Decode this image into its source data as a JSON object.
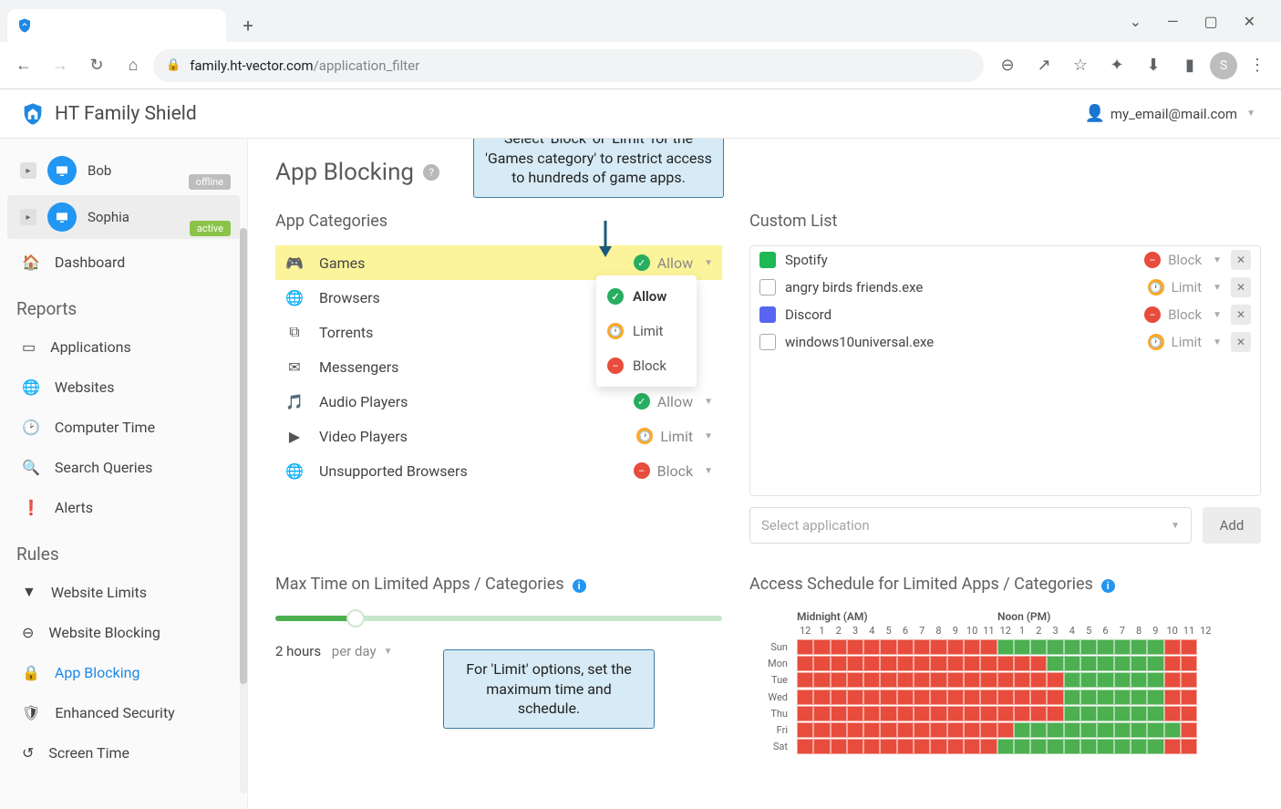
{
  "browser": {
    "url_host": "family.ht-vector.com",
    "url_path": "/application_filter",
    "avatar_letter": "S",
    "win": {
      "chev": "⌄",
      "min": "—",
      "max": "▢",
      "close": "✕"
    },
    "nav": {
      "back": "←",
      "forward": "→",
      "reload": "↻",
      "home": "⌂",
      "zoom": "⊖",
      "share": "↗",
      "star": "☆",
      "ext": "✦",
      "dl": "⬇",
      "panel": "▮",
      "menu": "⋮",
      "plus": "+",
      "lock": "🔒"
    }
  },
  "app": {
    "brand": "HT Family Shield",
    "user_email": "my_email@mail.com"
  },
  "sidebar": {
    "profiles": [
      {
        "name": "Bob",
        "status": "offline"
      },
      {
        "name": "Sophia",
        "status": "active"
      }
    ],
    "dashboard": "Dashboard",
    "sections": {
      "reports_title": "Reports",
      "reports": [
        "Applications",
        "Websites",
        "Computer Time",
        "Search Queries",
        "Alerts"
      ],
      "rules_title": "Rules",
      "rules": [
        "Website Limits",
        "Website Blocking",
        "App Blocking",
        "Enhanced Security",
        "Screen Time"
      ]
    }
  },
  "page": {
    "title": "App Blocking",
    "categories_title": "App Categories",
    "custom_title": "Custom List",
    "categories": [
      {
        "name": "Games",
        "status": "Allow",
        "status_kind": "allow",
        "highlight": true,
        "icon": "🎮"
      },
      {
        "name": "Browsers",
        "status": "",
        "status_kind": "",
        "icon": "🌐"
      },
      {
        "name": "Torrents",
        "status": "",
        "status_kind": "",
        "icon": "⧉"
      },
      {
        "name": "Messengers",
        "status": "",
        "status_kind": "",
        "icon": "✉"
      },
      {
        "name": "Audio Players",
        "status": "Allow",
        "status_kind": "allow",
        "icon": "🎵"
      },
      {
        "name": "Video Players",
        "status": "Limit",
        "status_kind": "limit",
        "icon": "▶"
      },
      {
        "name": "Unsupported Browsers",
        "status": "Block",
        "status_kind": "block",
        "icon": "🌐"
      }
    ],
    "dropdown": {
      "allow": "Allow",
      "limit": "Limit",
      "block": "Block"
    },
    "custom_list": [
      {
        "name": "Spotify",
        "status": "Block",
        "status_kind": "block",
        "color": "#1db954"
      },
      {
        "name": "angry birds friends.exe",
        "status": "Limit",
        "status_kind": "limit",
        "color": "#ffffff",
        "border": true
      },
      {
        "name": "Discord",
        "status": "Block",
        "status_kind": "block",
        "color": "#5865f2"
      },
      {
        "name": "windows10universal.exe",
        "status": "Limit",
        "status_kind": "limit",
        "color": "#ffffff",
        "border": true
      }
    ],
    "select_placeholder": "Select application",
    "add_btn": "Add",
    "maxtime": {
      "title": "Max Time on Limited Apps / Categories",
      "value_label": "2 hours",
      "unit_label": "per day"
    },
    "schedule": {
      "title": "Access Schedule for Limited Apps / Categories",
      "col_headers": [
        "Midnight (AM)",
        "Noon (PM)"
      ],
      "hours": [
        "12",
        "1",
        "2",
        "3",
        "4",
        "5",
        "6",
        "7",
        "8",
        "9",
        "10",
        "11",
        "12",
        "1",
        "2",
        "3",
        "4",
        "5",
        "6",
        "7",
        "8",
        "9",
        "10",
        "11",
        "12"
      ],
      "days": [
        "Sun",
        "Mon",
        "Tue",
        "Wed",
        "Thu",
        "Fri",
        "Sat"
      ]
    }
  },
  "callouts": {
    "top": "Select 'Block' or 'Limit' for the 'Games category' to restrict access to hundreds of game apps.",
    "bottom": "For 'Limit' options, set the maximum time and schedule."
  },
  "chart_data": {
    "type": "heatmap",
    "title": "Access Schedule for Limited Apps / Categories",
    "x_categories_hours_from_midnight": [
      0,
      1,
      2,
      3,
      4,
      5,
      6,
      7,
      8,
      9,
      10,
      11,
      12,
      13,
      14,
      15,
      16,
      17,
      18,
      19,
      20,
      21,
      22,
      23
    ],
    "y_categories_days": [
      "Sun",
      "Mon",
      "Tue",
      "Wed",
      "Thu",
      "Fri",
      "Sat"
    ],
    "legend": {
      "0": "blocked (red)",
      "1": "allowed (green)"
    },
    "values": [
      [
        0,
        0,
        0,
        0,
        0,
        0,
        0,
        0,
        0,
        0,
        0,
        0,
        1,
        1,
        1,
        1,
        1,
        1,
        1,
        1,
        1,
        1,
        0,
        0
      ],
      [
        0,
        0,
        0,
        0,
        0,
        0,
        0,
        0,
        0,
        0,
        0,
        0,
        0,
        0,
        0,
        1,
        1,
        1,
        1,
        1,
        1,
        1,
        0,
        0
      ],
      [
        0,
        0,
        0,
        0,
        0,
        0,
        0,
        0,
        0,
        0,
        0,
        0,
        0,
        0,
        0,
        0,
        1,
        1,
        1,
        1,
        1,
        1,
        0,
        0
      ],
      [
        0,
        0,
        0,
        0,
        0,
        0,
        0,
        0,
        0,
        0,
        0,
        0,
        0,
        0,
        0,
        0,
        1,
        1,
        1,
        1,
        1,
        1,
        0,
        0
      ],
      [
        0,
        0,
        0,
        0,
        0,
        0,
        0,
        0,
        0,
        0,
        0,
        0,
        0,
        0,
        0,
        0,
        1,
        1,
        1,
        1,
        1,
        1,
        0,
        0
      ],
      [
        0,
        0,
        0,
        0,
        0,
        0,
        0,
        0,
        0,
        0,
        0,
        0,
        0,
        1,
        1,
        1,
        1,
        1,
        1,
        1,
        1,
        1,
        1,
        0
      ],
      [
        0,
        0,
        0,
        0,
        0,
        0,
        0,
        0,
        0,
        0,
        0,
        0,
        1,
        1,
        1,
        1,
        1,
        1,
        1,
        1,
        1,
        1,
        0,
        0
      ]
    ]
  }
}
